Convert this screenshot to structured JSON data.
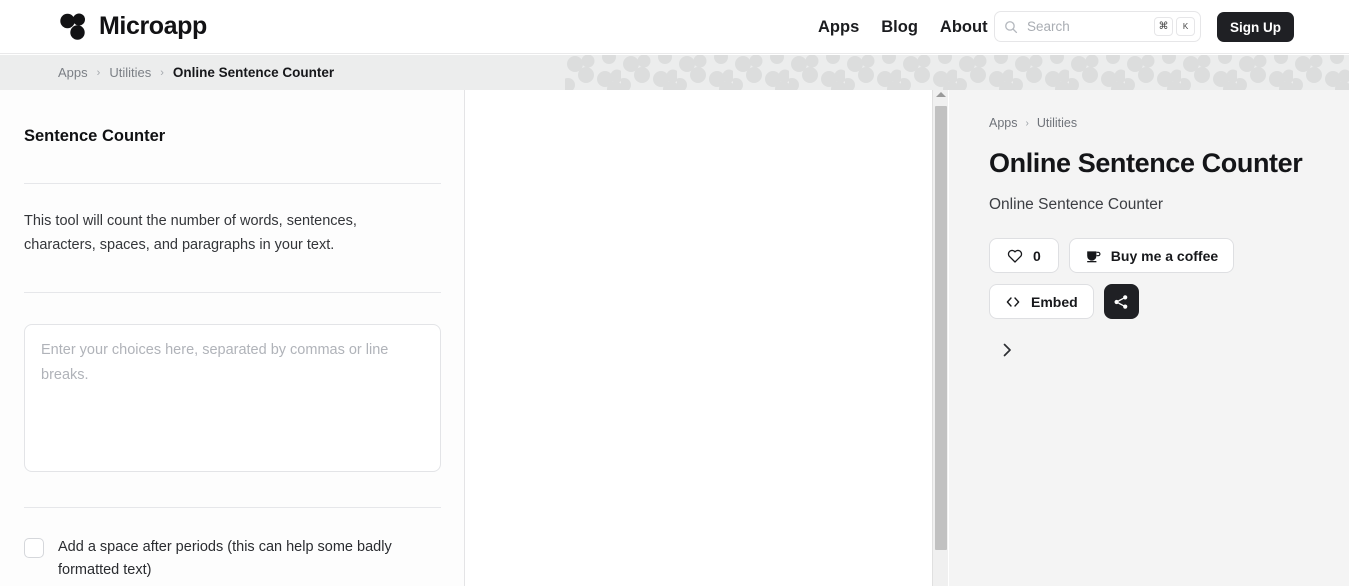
{
  "header": {
    "brand": {
      "name": "Microapp",
      "logo_icon": "clover-logo-icon"
    },
    "nav": [
      {
        "label": "Apps",
        "name": "nav-apps"
      },
      {
        "label": "Blog",
        "name": "nav-blog"
      },
      {
        "label": "About",
        "name": "nav-about"
      }
    ],
    "search": {
      "placeholder": "Search",
      "icon": "search-icon",
      "kbd_cmd": "⌘",
      "kbd_key": "K"
    },
    "signup_label": "Sign Up"
  },
  "breadcrumb_bar": {
    "items": [
      {
        "label": "Apps",
        "active": false
      },
      {
        "label": "Utilities",
        "active": false
      },
      {
        "label": "Online Sentence Counter",
        "active": true
      }
    ],
    "separator": "›",
    "pattern_icon": "clover-pattern-icon",
    "accent_logo_icon": "clover-logo-icon"
  },
  "left_panel": {
    "title": "Sentence Counter",
    "description": "This tool will count the number of words, sentences, characters, spaces, and paragraphs in your text.",
    "textarea": {
      "value": "",
      "placeholder": "Enter your choices here, separated by commas or line breaks."
    },
    "checkbox": {
      "label": "Add a space after periods (this can help some badly formatted text)",
      "checked": false
    }
  },
  "scrollbar": {
    "up_arrow_icon": "chevron-up-icon"
  },
  "right_panel": {
    "breadcrumb": [
      {
        "label": "Apps"
      },
      {
        "label": "Utilities"
      }
    ],
    "separator": "›",
    "title": "Online Sentence Counter",
    "subtitle": "Online Sentence Counter",
    "buttons": {
      "like": {
        "label": "0",
        "icon": "heart-icon"
      },
      "coffee": {
        "label": "Buy me a coffee",
        "icon": "coffee-cup-icon"
      },
      "embed": {
        "label": "Embed",
        "icon": "code-brackets-icon"
      },
      "share": {
        "label": "",
        "icon": "share-nodes-icon"
      }
    },
    "expand_icon": "chevron-right-icon"
  },
  "colors": {
    "dark": "#1f2024",
    "bar_bg": "#eceded",
    "right_bg": "#f4f4f4",
    "muted_text": "#7c8086"
  }
}
